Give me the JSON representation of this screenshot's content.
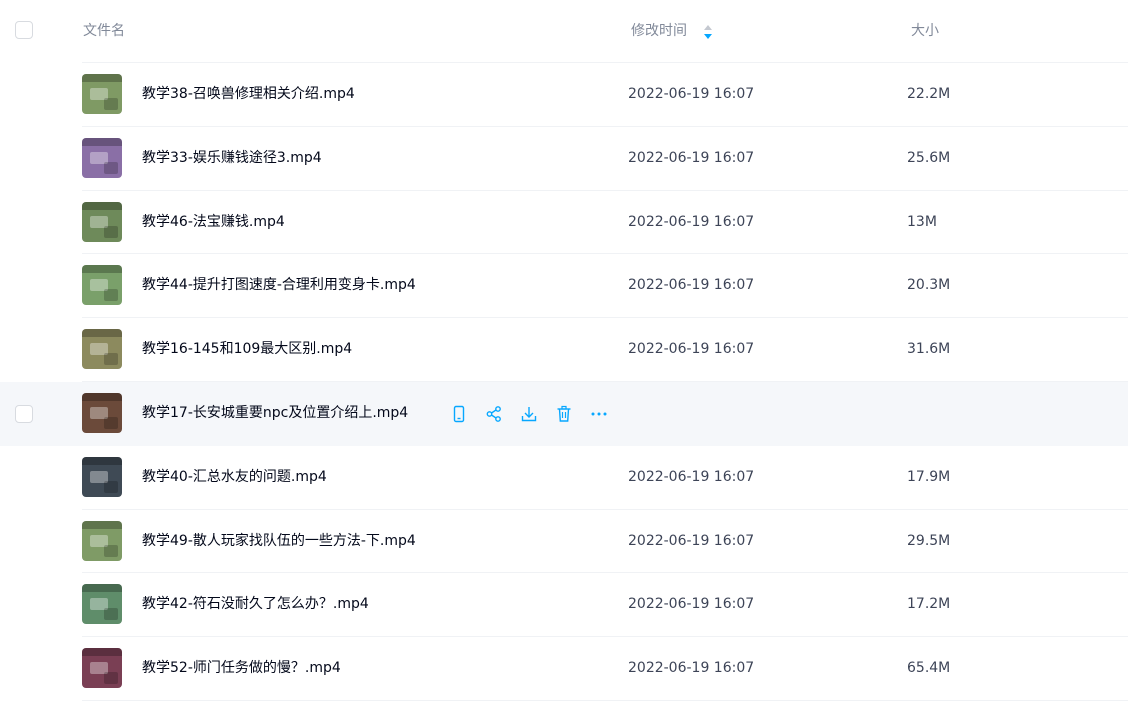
{
  "header": {
    "name_label": "文件名",
    "time_label": "修改时间",
    "size_label": "大小"
  },
  "colors": {
    "accent": "#06a7ff",
    "text_primary": "#03081a",
    "text_secondary": "#818999",
    "hover_row": "#f5f7fa"
  },
  "hover_actions": [
    "phone-icon",
    "share-icon",
    "download-icon",
    "delete-icon",
    "more-icon"
  ],
  "rows": [
    {
      "name": "教学38-召唤兽修理相关介绍.mp4",
      "time": "2022-06-19 16:07",
      "size": "22.2M",
      "thumb": "#7f9a64"
    },
    {
      "name": "教学33-娱乐赚钱途径3.mp4",
      "time": "2022-06-19 16:07",
      "size": "25.6M",
      "thumb": "#8a6fa6"
    },
    {
      "name": "教学46-法宝赚钱.mp4",
      "time": "2022-06-19 16:07",
      "size": "13M",
      "thumb": "#6e8a5a"
    },
    {
      "name": "教学44-提升打图速度-合理利用变身卡.mp4",
      "time": "2022-06-19 16:07",
      "size": "20.3M",
      "thumb": "#7aa06a"
    },
    {
      "name": "教学16-145和109最大区别.mp4",
      "time": "2022-06-19 16:07",
      "size": "31.6M",
      "thumb": "#8c8a5e"
    },
    {
      "name": "教学17-长安城重要npc及位置介绍上.mp4",
      "time": "",
      "size": "",
      "thumb": "#6b4a3a",
      "hover": true
    },
    {
      "name": "教学40-汇总水友的问题.mp4",
      "time": "2022-06-19 16:07",
      "size": "17.9M",
      "thumb": "#3f4a55"
    },
    {
      "name": "教学49-散人玩家找队伍的一些方法-下.mp4",
      "time": "2022-06-19 16:07",
      "size": "29.5M",
      "thumb": "#7f9b66"
    },
    {
      "name": "教学42-符石没耐久了怎么办？.mp4",
      "time": "2022-06-19 16:07",
      "size": "17.2M",
      "thumb": "#5f8d6a"
    },
    {
      "name": "教学52-师门任务做的慢？.mp4",
      "time": "2022-06-19 16:07",
      "size": "65.4M",
      "thumb": "#7a3f54"
    }
  ]
}
